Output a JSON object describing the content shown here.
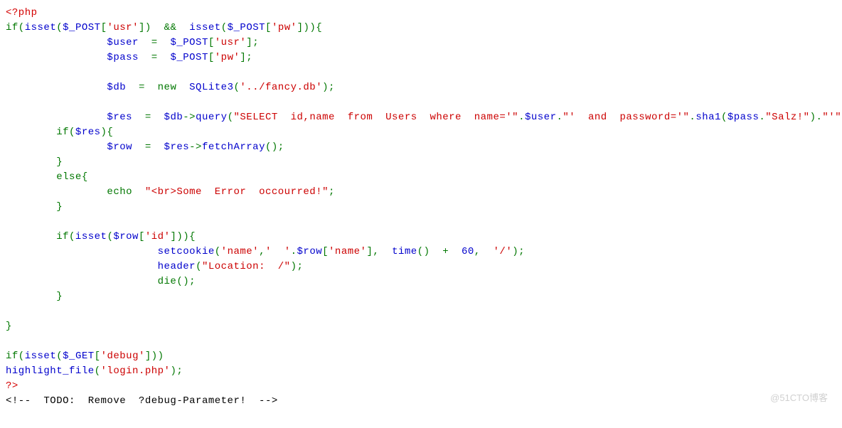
{
  "lines": [
    {
      "t": [
        {
          "c": "k-php",
          "s": "<?php"
        }
      ]
    },
    {
      "t": [
        {
          "c": "k-green",
          "s": "if("
        },
        {
          "c": "k-blue",
          "s": "isset"
        },
        {
          "c": "k-green",
          "s": "("
        },
        {
          "c": "k-blue",
          "s": "$_POST"
        },
        {
          "c": "k-green",
          "s": "["
        },
        {
          "c": "k-str",
          "s": "'usr'"
        },
        {
          "c": "k-green",
          "s": "])  &&  "
        },
        {
          "c": "k-blue",
          "s": "isset"
        },
        {
          "c": "k-green",
          "s": "("
        },
        {
          "c": "k-blue",
          "s": "$_POST"
        },
        {
          "c": "k-green",
          "s": "["
        },
        {
          "c": "k-str",
          "s": "'pw'"
        },
        {
          "c": "k-green",
          "s": "])){"
        }
      ]
    },
    {
      "t": [
        {
          "c": "k-green",
          "s": "                "
        },
        {
          "c": "k-blue",
          "s": "$user"
        },
        {
          "c": "k-green",
          "s": "  =  "
        },
        {
          "c": "k-blue",
          "s": "$_POST"
        },
        {
          "c": "k-green",
          "s": "["
        },
        {
          "c": "k-str",
          "s": "'usr'"
        },
        {
          "c": "k-green",
          "s": "];"
        }
      ]
    },
    {
      "t": [
        {
          "c": "k-green",
          "s": "                "
        },
        {
          "c": "k-blue",
          "s": "$pass"
        },
        {
          "c": "k-green",
          "s": "  =  "
        },
        {
          "c": "k-blue",
          "s": "$_POST"
        },
        {
          "c": "k-green",
          "s": "["
        },
        {
          "c": "k-str",
          "s": "'pw'"
        },
        {
          "c": "k-green",
          "s": "];"
        }
      ]
    },
    {
      "t": [
        {
          "c": "",
          "s": " "
        }
      ]
    },
    {
      "t": [
        {
          "c": "k-green",
          "s": "                "
        },
        {
          "c": "k-blue",
          "s": "$db"
        },
        {
          "c": "k-green",
          "s": "  =  new  "
        },
        {
          "c": "k-blue",
          "s": "SQLite3"
        },
        {
          "c": "k-green",
          "s": "("
        },
        {
          "c": "k-str",
          "s": "'../fancy.db'"
        },
        {
          "c": "k-green",
          "s": ");"
        }
      ]
    },
    {
      "t": [
        {
          "c": "",
          "s": " "
        }
      ]
    },
    {
      "t": [
        {
          "c": "k-green",
          "s": "                "
        },
        {
          "c": "k-blue",
          "s": "$res"
        },
        {
          "c": "k-green",
          "s": "  =  "
        },
        {
          "c": "k-blue",
          "s": "$db"
        },
        {
          "c": "k-green",
          "s": "->"
        },
        {
          "c": "k-blue",
          "s": "query"
        },
        {
          "c": "k-green",
          "s": "("
        },
        {
          "c": "k-str",
          "s": "\"SELECT  id,name  from  Users  where  name='\""
        },
        {
          "c": "k-green",
          "s": "."
        },
        {
          "c": "k-blue",
          "s": "$user"
        },
        {
          "c": "k-green",
          "s": "."
        },
        {
          "c": "k-str",
          "s": "\"'  and  password='\""
        },
        {
          "c": "k-green",
          "s": "."
        },
        {
          "c": "k-blue",
          "s": "sha1"
        },
        {
          "c": "k-green",
          "s": "("
        },
        {
          "c": "k-blue",
          "s": "$pass"
        },
        {
          "c": "k-green",
          "s": "."
        },
        {
          "c": "k-str",
          "s": "\"Salz!\""
        },
        {
          "c": "k-green",
          "s": ")."
        },
        {
          "c": "k-str",
          "s": "\"'\""
        },
        {
          "c": "k-green",
          "s": ");"
        }
      ]
    },
    {
      "t": [
        {
          "c": "k-green",
          "s": "        if("
        },
        {
          "c": "k-blue",
          "s": "$res"
        },
        {
          "c": "k-green",
          "s": "){"
        }
      ]
    },
    {
      "t": [
        {
          "c": "k-green",
          "s": "                "
        },
        {
          "c": "k-blue",
          "s": "$row"
        },
        {
          "c": "k-green",
          "s": "  =  "
        },
        {
          "c": "k-blue",
          "s": "$res"
        },
        {
          "c": "k-green",
          "s": "->"
        },
        {
          "c": "k-blue",
          "s": "fetchArray"
        },
        {
          "c": "k-green",
          "s": "();"
        }
      ]
    },
    {
      "t": [
        {
          "c": "k-green",
          "s": "        }"
        }
      ]
    },
    {
      "t": [
        {
          "c": "k-green",
          "s": "        else{"
        }
      ]
    },
    {
      "t": [
        {
          "c": "k-green",
          "s": "                echo  "
        },
        {
          "c": "k-str",
          "s": "\"<br>Some  Error  occourred!\""
        },
        {
          "c": "k-green",
          "s": ";"
        }
      ]
    },
    {
      "t": [
        {
          "c": "k-green",
          "s": "        }"
        }
      ]
    },
    {
      "t": [
        {
          "c": "",
          "s": " "
        }
      ]
    },
    {
      "t": [
        {
          "c": "k-green",
          "s": "        if("
        },
        {
          "c": "k-blue",
          "s": "isset"
        },
        {
          "c": "k-green",
          "s": "("
        },
        {
          "c": "k-blue",
          "s": "$row"
        },
        {
          "c": "k-green",
          "s": "["
        },
        {
          "c": "k-str",
          "s": "'id'"
        },
        {
          "c": "k-green",
          "s": "])){"
        }
      ]
    },
    {
      "t": [
        {
          "c": "k-green",
          "s": "                        "
        },
        {
          "c": "k-blue",
          "s": "setcookie"
        },
        {
          "c": "k-green",
          "s": "("
        },
        {
          "c": "k-str",
          "s": "'name'"
        },
        {
          "c": "k-green",
          "s": ","
        },
        {
          "c": "k-str",
          "s": "'  '"
        },
        {
          "c": "k-green",
          "s": "."
        },
        {
          "c": "k-blue",
          "s": "$row"
        },
        {
          "c": "k-green",
          "s": "["
        },
        {
          "c": "k-str",
          "s": "'name'"
        },
        {
          "c": "k-green",
          "s": "],  "
        },
        {
          "c": "k-blue",
          "s": "time"
        },
        {
          "c": "k-green",
          "s": "()  +  "
        },
        {
          "c": "k-blue",
          "s": "60"
        },
        {
          "c": "k-green",
          "s": ",  "
        },
        {
          "c": "k-str",
          "s": "'/'"
        },
        {
          "c": "k-green",
          "s": ");"
        }
      ]
    },
    {
      "t": [
        {
          "c": "k-green",
          "s": "                        "
        },
        {
          "c": "k-blue",
          "s": "header"
        },
        {
          "c": "k-green",
          "s": "("
        },
        {
          "c": "k-str",
          "s": "\"Location:  /\""
        },
        {
          "c": "k-green",
          "s": ");"
        }
      ]
    },
    {
      "t": [
        {
          "c": "k-green",
          "s": "                        die();"
        }
      ]
    },
    {
      "t": [
        {
          "c": "k-green",
          "s": "        }"
        }
      ]
    },
    {
      "t": [
        {
          "c": "",
          "s": " "
        }
      ]
    },
    {
      "t": [
        {
          "c": "k-green",
          "s": "}"
        }
      ]
    },
    {
      "t": [
        {
          "c": "",
          "s": " "
        }
      ]
    },
    {
      "t": [
        {
          "c": "k-green",
          "s": "if("
        },
        {
          "c": "k-blue",
          "s": "isset"
        },
        {
          "c": "k-green",
          "s": "("
        },
        {
          "c": "k-blue",
          "s": "$_GET"
        },
        {
          "c": "k-green",
          "s": "["
        },
        {
          "c": "k-str",
          "s": "'debug'"
        },
        {
          "c": "k-green",
          "s": "]))"
        }
      ]
    },
    {
      "t": [
        {
          "c": "k-blue",
          "s": "highlight_file"
        },
        {
          "c": "k-green",
          "s": "("
        },
        {
          "c": "k-str",
          "s": "'login.php'"
        },
        {
          "c": "k-green",
          "s": ");"
        }
      ]
    },
    {
      "t": [
        {
          "c": "k-php",
          "s": "?>"
        }
      ]
    },
    {
      "t": [
        {
          "c": "k-black",
          "s": "<!--  TODO:  Remove  ?debug-Parameter!  -->"
        }
      ]
    }
  ],
  "watermark": "@51CTO博客"
}
